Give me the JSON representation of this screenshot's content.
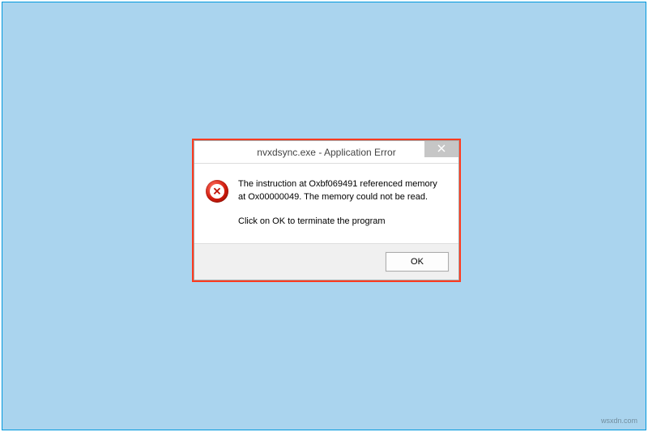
{
  "dialog": {
    "title": "nvxdsync.exe - Application Error",
    "close_label": "Close",
    "message_line1": "The instruction at Oxbf069491 referenced memory at Ox00000049. The memory could not be read.",
    "message_line2": "Click on OK to terminate the program",
    "ok_label": "OK"
  },
  "icons": {
    "error": "error-icon",
    "close": "close-icon"
  },
  "watermark": "wsxdn.com"
}
